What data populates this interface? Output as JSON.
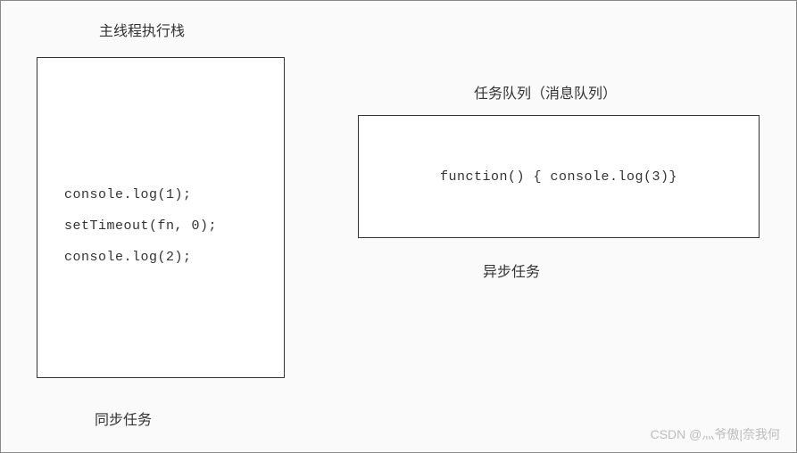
{
  "leftBox": {
    "title": "主线程执行栈",
    "lines": [
      "console.log(1);",
      "setTimeout(fn,  0);",
      "console.log(2);"
    ],
    "bottomLabel": "同步任务"
  },
  "rightBox": {
    "title": "任务队列（消息队列）",
    "content": "function() {  console.log(3)}",
    "bottomLabel": "异步任务"
  },
  "watermark": "CSDN @灬爷傲|奈我何"
}
